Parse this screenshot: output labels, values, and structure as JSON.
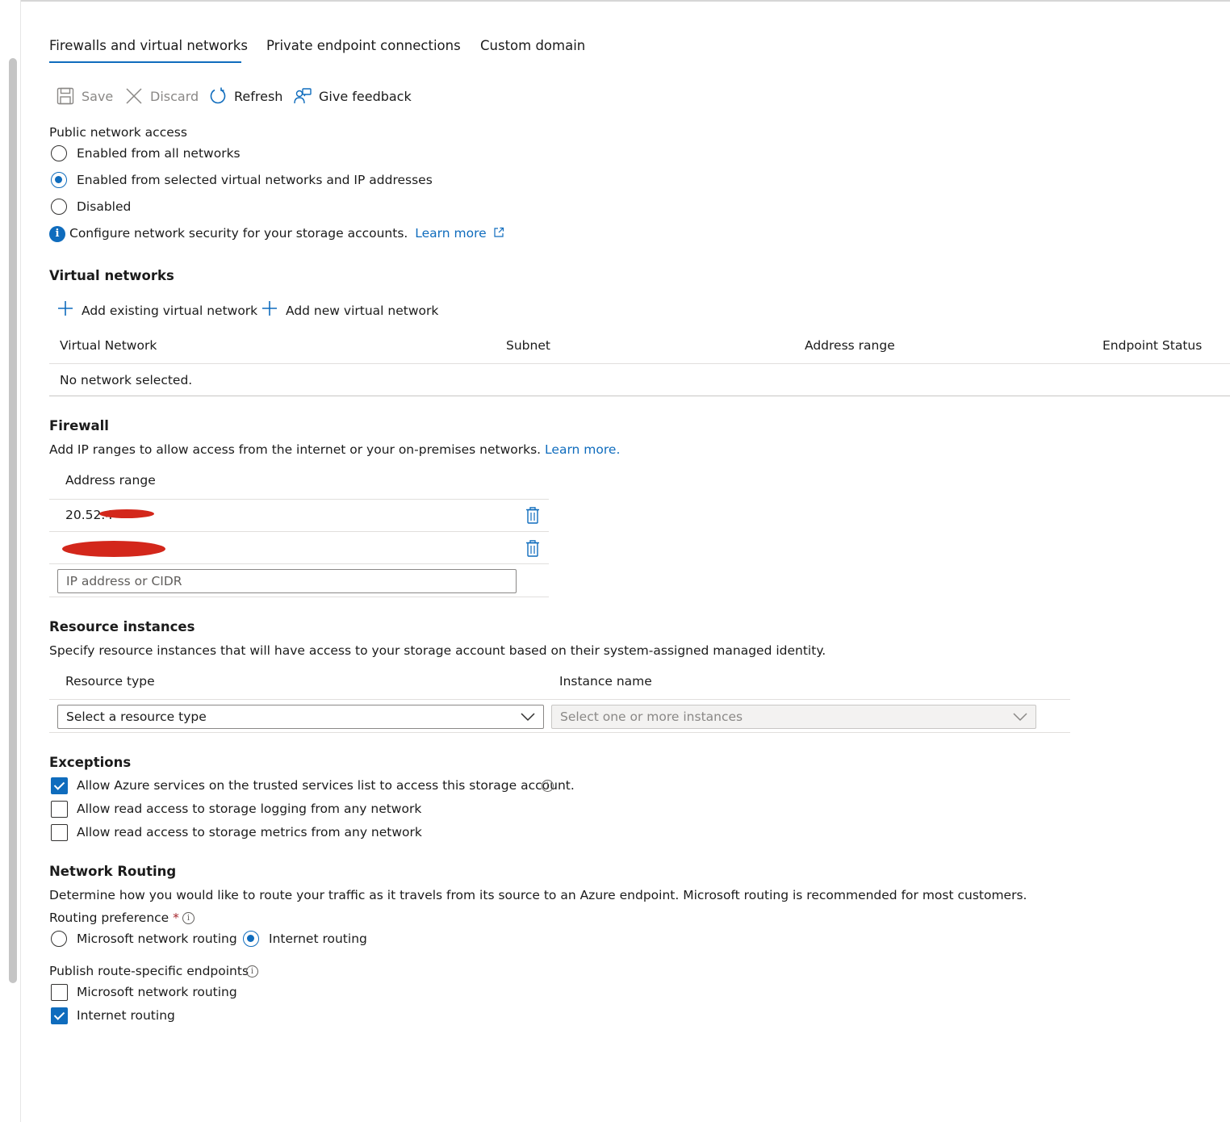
{
  "tabs": [
    {
      "label": "Firewalls and virtual networks",
      "active": true
    },
    {
      "label": "Private endpoint connections",
      "active": false
    },
    {
      "label": "Custom domain",
      "active": false
    }
  ],
  "toolbar": {
    "save": "Save",
    "discard": "Discard",
    "refresh": "Refresh",
    "feedback": "Give feedback"
  },
  "public_access": {
    "label": "Public network access",
    "options": [
      {
        "label": "Enabled from all networks",
        "selected": false
      },
      {
        "label": "Enabled from selected virtual networks and IP addresses",
        "selected": true
      },
      {
        "label": "Disabled",
        "selected": false
      }
    ],
    "info_text": "Configure network security for your storage accounts.",
    "learn_more": "Learn more"
  },
  "virtual_networks": {
    "title": "Virtual networks",
    "add_existing": "Add existing virtual network",
    "add_new": "Add new virtual network",
    "columns": [
      "Virtual Network",
      "Subnet",
      "Address range",
      "Endpoint Status"
    ],
    "empty_text": "No network selected."
  },
  "firewall": {
    "title": "Firewall",
    "description": "Add IP ranges to allow access from the internet or your on-premises networks.",
    "learn_more": "Learn more.",
    "column": "Address range",
    "rows": [
      "20.52.4"
    ],
    "input_placeholder": "IP address or CIDR"
  },
  "resource_instances": {
    "title": "Resource instances",
    "description": "Specify resource instances that will have access to your storage account based on their system-assigned managed identity.",
    "col_type": "Resource type",
    "col_instance": "Instance name",
    "type_placeholder": "Select a resource type",
    "instance_placeholder": "Select one or more instances"
  },
  "exceptions": {
    "title": "Exceptions",
    "items": [
      {
        "label": "Allow Azure services on the trusted services list to access this storage account.",
        "checked": true
      },
      {
        "label": "Allow read access to storage logging from any network",
        "checked": false
      },
      {
        "label": "Allow read access to storage metrics from any network",
        "checked": false
      }
    ]
  },
  "routing": {
    "title": "Network Routing",
    "description": "Determine how you would like to route your traffic as it travels from its source to an Azure endpoint. Microsoft routing is recommended for most customers.",
    "preference_label": "Routing preference",
    "required_mark": "*",
    "preference_options": [
      {
        "label": "Microsoft network routing",
        "selected": false
      },
      {
        "label": "Internet routing",
        "selected": true
      }
    ],
    "publish_label": "Publish route-specific endpoints",
    "publish_options": [
      {
        "label": "Microsoft network routing",
        "checked": false
      },
      {
        "label": "Internet routing",
        "checked": true
      }
    ]
  },
  "colors": {
    "accent": "#0f6cbd",
    "redaction": "#d3271b",
    "divider": "#e1dfdd"
  }
}
